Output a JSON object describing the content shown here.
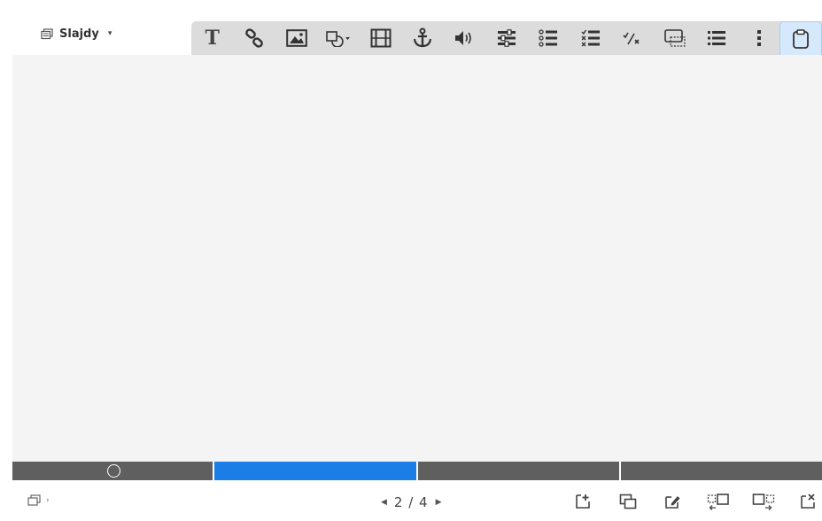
{
  "topbar": {
    "slides_menu": {
      "label": "Slajdy",
      "icon": "slides-icon",
      "caret": "▾"
    },
    "toolbar_buttons": [
      {
        "name": "text",
        "icon": "text-icon",
        "glyph": "T"
      },
      {
        "name": "link",
        "icon": "link-icon"
      },
      {
        "name": "image",
        "icon": "image-icon"
      },
      {
        "name": "shape",
        "icon": "shape-icon"
      },
      {
        "name": "video",
        "icon": "film-icon"
      },
      {
        "name": "anchor",
        "icon": "anchor-icon"
      },
      {
        "name": "audio",
        "icon": "speaker-icon"
      },
      {
        "name": "slider",
        "icon": "sliders-icon"
      },
      {
        "name": "multiple-choice",
        "icon": "radio-list-icon"
      },
      {
        "name": "checklist",
        "icon": "checklist-icon"
      },
      {
        "name": "fraction",
        "icon": "fraction-icon"
      },
      {
        "name": "hotspot",
        "icon": "hotspot-icon"
      },
      {
        "name": "list",
        "icon": "list-icon"
      },
      {
        "name": "more",
        "icon": "more-vertical-icon"
      },
      {
        "name": "clipboard",
        "icon": "clipboard-icon",
        "active": true
      }
    ]
  },
  "timeline": {
    "segments": 4,
    "active_segment": 2,
    "active_color": "#1a7ee6",
    "inactive_color": "#5f5f5f"
  },
  "bottombar": {
    "layout_icon": "layout-icon",
    "pager": {
      "prev": "◀",
      "text": "2 / 4",
      "next": "▶",
      "current": 2,
      "total": 4
    },
    "actions": [
      {
        "name": "add-slide",
        "icon": "add-slide-icon"
      },
      {
        "name": "duplicate-slide",
        "icon": "duplicate-slide-icon"
      },
      {
        "name": "edit-slide",
        "icon": "edit-slide-icon"
      },
      {
        "name": "move-slide-left",
        "icon": "move-left-icon"
      },
      {
        "name": "move-slide-right",
        "icon": "move-right-icon"
      },
      {
        "name": "delete-slide",
        "icon": "delete-slide-icon"
      }
    ]
  }
}
